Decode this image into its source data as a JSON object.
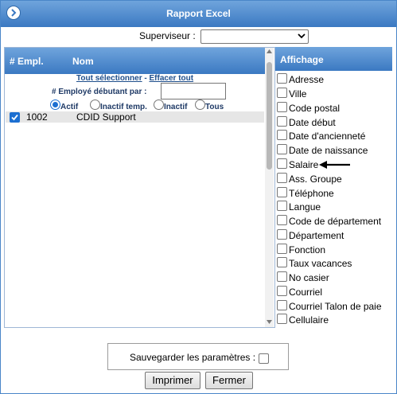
{
  "window": {
    "title": "Rapport Excel"
  },
  "supervisor": {
    "label": "Superviseur :",
    "value": ""
  },
  "list": {
    "col_empl": "# Empl.",
    "col_nom": "Nom",
    "select_all": "Tout sélectionner",
    "separator": "-",
    "clear_all": "Effacer tout",
    "starting_employee_label": "# Employé débutant par :",
    "starting_employee_value": "",
    "status_filter": {
      "options": [
        "Actif",
        "Inactif temp.",
        "Inactif",
        "Tous"
      ],
      "selected": "Actif"
    },
    "rows": [
      {
        "checked": true,
        "number": "1002",
        "name": "CDID Support"
      }
    ]
  },
  "display": {
    "header": "Affichage",
    "options": [
      "Adresse",
      "Ville",
      "Code postal",
      "Date début",
      "Date d'ancienneté",
      "Date de naissance",
      "Salaire",
      "Ass. Groupe",
      "Téléphone",
      "Langue",
      "Code de département",
      "Département",
      "Fonction",
      "Taux vacances",
      "No casier",
      "Courriel",
      "Courriel Talon de paie",
      "Cellulaire"
    ],
    "annotation_arrow_points_to": "Salaire"
  },
  "save": {
    "label": "Sauvegarder les paramètres :",
    "checked": false
  },
  "buttons": {
    "print": "Imprimer",
    "close": "Fermer"
  },
  "icons": {
    "title_icon": "circle-arrow-right-icon"
  },
  "colors": {
    "header_blue": "#3b79c2",
    "link_blue": "#1f4f8c",
    "check_blue": "#1c6fd1"
  }
}
